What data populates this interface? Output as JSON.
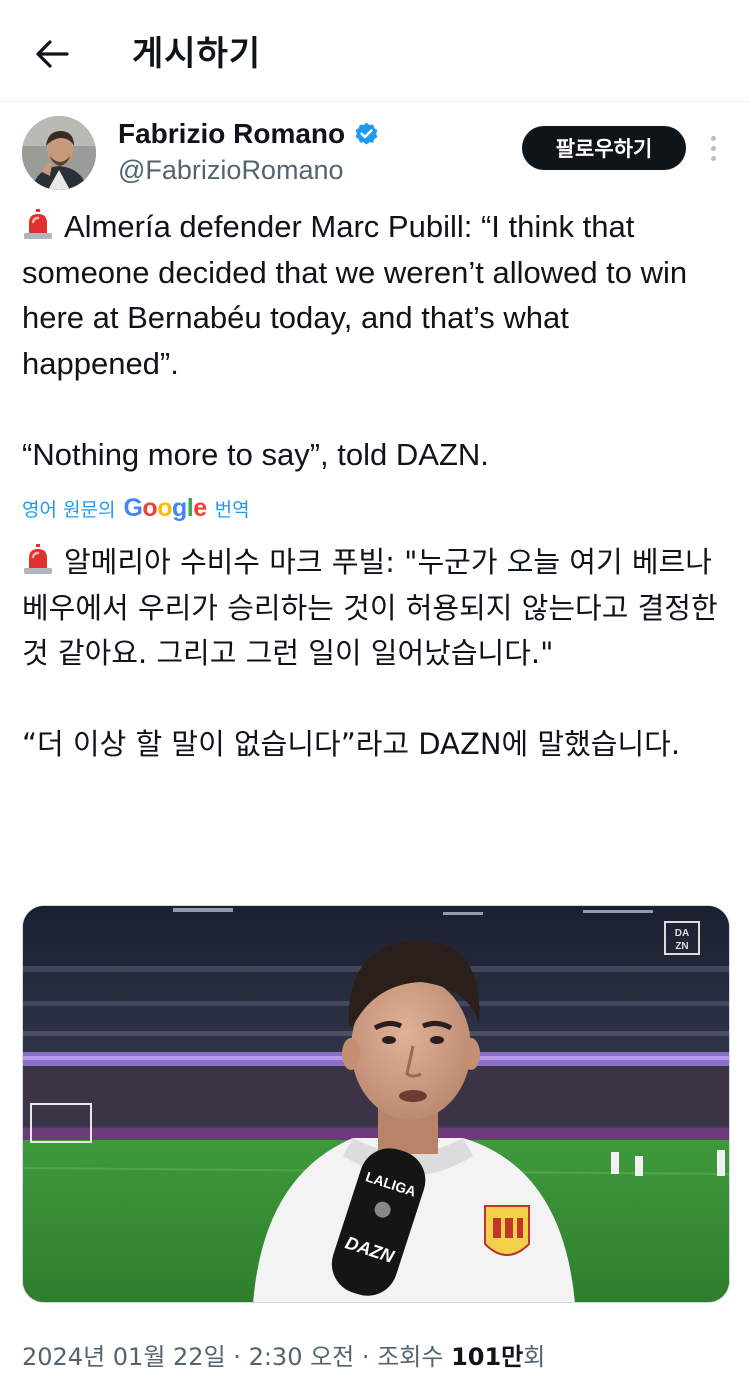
{
  "header": {
    "back_icon": "arrow-left-icon",
    "title": "게시하기"
  },
  "author": {
    "name": "Fabrizio Romano",
    "handle": "@FabrizioRomano",
    "verified_icon": "verified-badge-icon",
    "verified_color": "#1d9bf0",
    "follow_label": "팔로우하기",
    "more_icon": "more-vertical-icon"
  },
  "tweet": {
    "siren_icon": "rotating-light-icon",
    "text_en": "Almería defender Marc Pubill: “I think that someone decided that we weren’t allowed to win here at Bernabéu today, and that’s what happened”.\n\n“Nothing more to say”, told DAZN.",
    "translate_prefix": "영어 원문의",
    "translate_brand": "Google",
    "translate_suffix": "번역",
    "text_ko": "알메리아 수비수 마크 푸빌: \"누군가 오늘 여기 베르나베우에서 우리가 승리하는 것이 허용되지 않는다고 결정한 것 같아요. 그리고 그런 일이 일어났습니다.\"\n\n“더 이상 할 말이 없습니다”라고 DAZN에 말했습니다."
  },
  "media": {
    "broadcaster_logo": "DAZN",
    "mic_brand_top": "LALIGA",
    "mic_brand_bottom": "DAZN",
    "badge_text": "U.D. ALMERIA"
  },
  "meta": {
    "date": "2024년 01월 22일",
    "time": "2:30 오전",
    "views_label": "조회수",
    "views_count": "101만",
    "views_unit": "회",
    "separator": "·"
  },
  "colors": {
    "accent": "#1d9bf0",
    "text_primary": "#0f1419",
    "text_secondary": "#536471",
    "follow_bg": "#0f1419"
  }
}
